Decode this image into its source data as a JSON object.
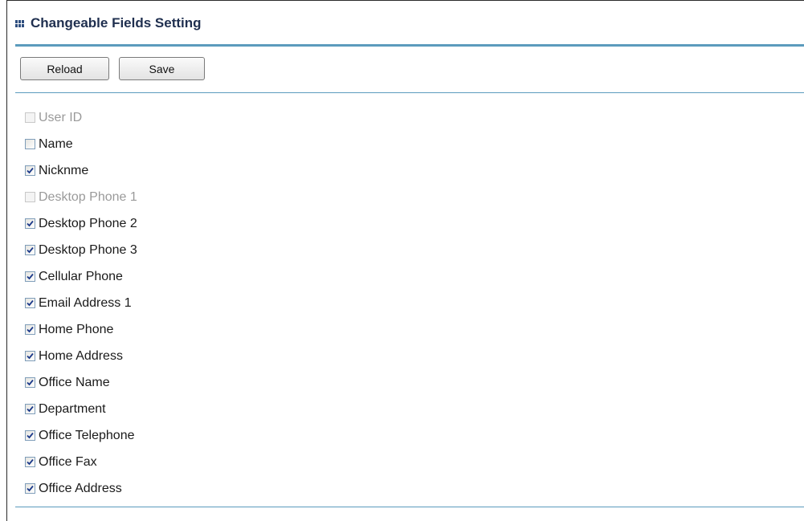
{
  "header": {
    "title": "Changeable Fields Setting",
    "icon": "grid-icon"
  },
  "toolbar": {
    "reload_label": "Reload",
    "save_label": "Save"
  },
  "colors": {
    "accent_rule": "#5b9bbd",
    "title_text": "#1f2f4f",
    "checkmark": "#1c3a8a",
    "disabled_text": "#9a9a9a"
  },
  "fields": [
    {
      "label": "User ID",
      "checked": false,
      "disabled": true
    },
    {
      "label": "Name",
      "checked": false,
      "disabled": false
    },
    {
      "label": "Nicknme",
      "checked": true,
      "disabled": false
    },
    {
      "label": "Desktop Phone 1",
      "checked": false,
      "disabled": true
    },
    {
      "label": "Desktop Phone 2",
      "checked": true,
      "disabled": false
    },
    {
      "label": "Desktop Phone 3",
      "checked": true,
      "disabled": false
    },
    {
      "label": "Cellular Phone",
      "checked": true,
      "disabled": false
    },
    {
      "label": "Email Address 1",
      "checked": true,
      "disabled": false
    },
    {
      "label": "Home Phone",
      "checked": true,
      "disabled": false
    },
    {
      "label": "Home Address",
      "checked": true,
      "disabled": false
    },
    {
      "label": "Office Name",
      "checked": true,
      "disabled": false
    },
    {
      "label": "Department",
      "checked": true,
      "disabled": false
    },
    {
      "label": "Office Telephone",
      "checked": true,
      "disabled": false
    },
    {
      "label": "Office Fax",
      "checked": true,
      "disabled": false
    },
    {
      "label": "Office Address",
      "checked": true,
      "disabled": false
    }
  ]
}
